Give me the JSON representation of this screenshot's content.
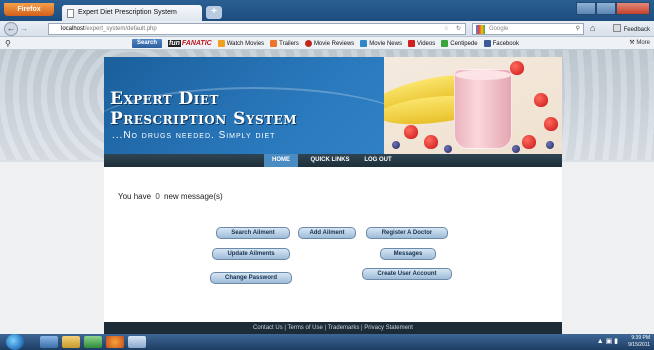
{
  "browser": {
    "app_button": "Firefox",
    "tab_title": "Expert Diet Prescription System",
    "new_tab": "+",
    "url_host": "localhost",
    "url_path": "/expert_system/default.php",
    "search_placeholder": "Google",
    "feedback": "Feedback"
  },
  "toolbar": {
    "search_button": "Search",
    "brand_fun": "fun",
    "brand_rest": "FANATIC",
    "links": [
      {
        "label": "Watch Movies",
        "icon": "h-icon",
        "color": "#f0a020"
      },
      {
        "label": "Trailers",
        "icon": "star-icon",
        "color": "#e8762c"
      },
      {
        "label": "Movie Reviews",
        "icon": "tomato-icon",
        "color": "#c0281e"
      },
      {
        "label": "Movie News",
        "icon": "news-icon",
        "color": "#2f86c8"
      },
      {
        "label": "Videos",
        "icon": "youtube-icon",
        "color": "#d02020"
      },
      {
        "label": "Centipede",
        "icon": "centipede-icon",
        "color": "#3aa53a"
      },
      {
        "label": "Facebook",
        "icon": "facebook-icon",
        "color": "#3b5998"
      }
    ],
    "more": "More"
  },
  "site": {
    "title_line1": "Expert Diet",
    "title_line2": "Prescription System",
    "tagline": "...No drugs needed. Simply diet",
    "menu": {
      "home": "HOME",
      "quick_links": "QUICK LINKS",
      "logout": "LOG OUT"
    },
    "message": {
      "prefix": "You have",
      "count": "0",
      "suffix": "new message(s)"
    },
    "buttons": {
      "search_ailment": "Search Ailment",
      "add_ailment": "Add Ailment",
      "register_doctor": "Register A Doctor",
      "update_ailments": "Update Ailments",
      "messages": "Messages",
      "change_password": "Change Password",
      "create_user": "Create User Account"
    },
    "footer": "Contact Us | Terms of Use | Trademarks | Privacy Statement"
  },
  "taskbar": {
    "time": "9:39 PM",
    "date": "9/15/2011"
  }
}
